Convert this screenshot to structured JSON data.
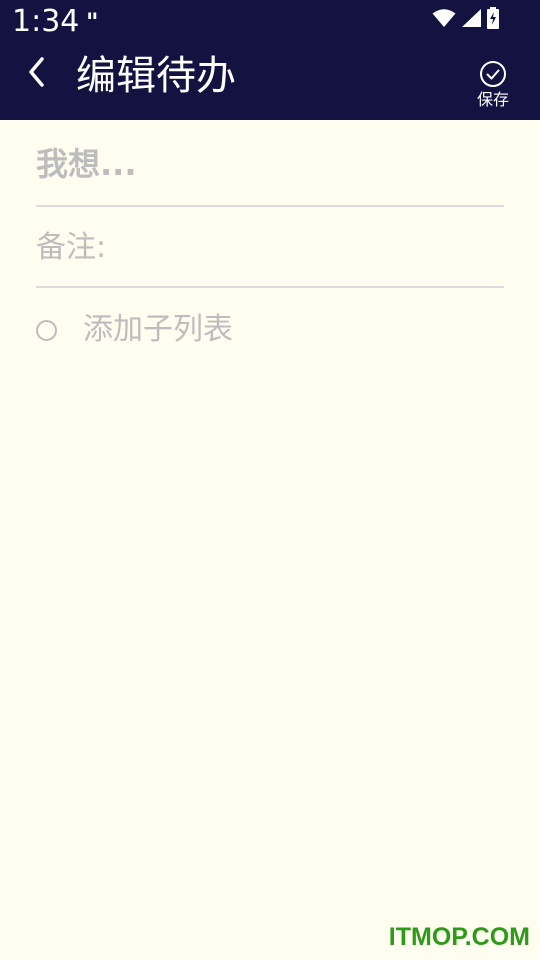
{
  "status_bar": {
    "time": "1:34",
    "notification_glyph": "\"",
    "icons": [
      "wifi-icon",
      "signal-icon",
      "battery-charging-icon"
    ]
  },
  "header": {
    "title": "编辑待办",
    "back_icon": "chevron-left-icon",
    "save_icon": "check-circle-icon",
    "save_label": "保存"
  },
  "form": {
    "title_placeholder": "我想...",
    "note_placeholder": "备注:",
    "subtask_label": "添加子列表"
  },
  "watermark": "ITMOP.COM",
  "colors": {
    "header_bg": "#141240",
    "page_bg": "#FEFDF0",
    "placeholder": "#BDBDBD",
    "divider": "#DCDCDC",
    "watermark": "#2E9A1A"
  }
}
